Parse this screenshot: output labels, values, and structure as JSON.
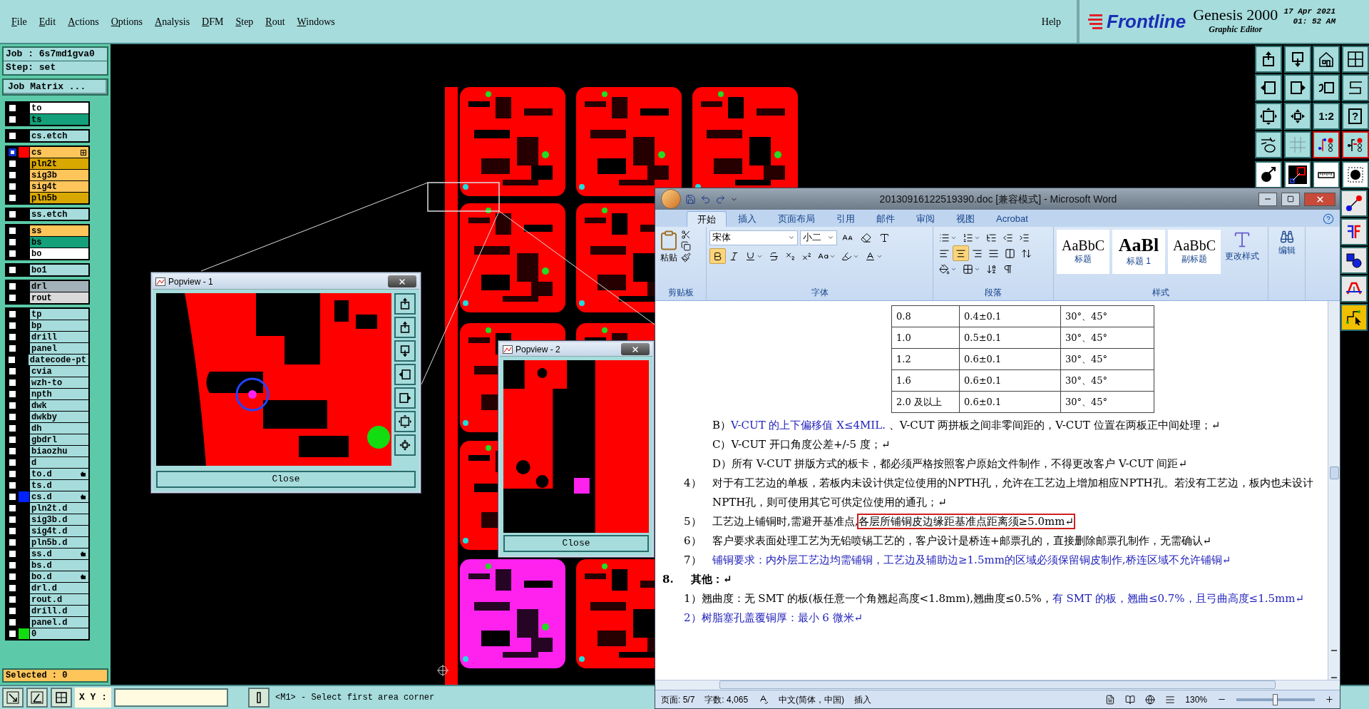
{
  "menubar": {
    "items": [
      "File",
      "Edit",
      "Actions",
      "Options",
      "Analysis",
      "DFM",
      "Step",
      "Rout",
      "Windows"
    ],
    "help": "Help"
  },
  "brand": {
    "logo": "Frontline",
    "product": "Genesis 2000",
    "subtitle": "Graphic Editor",
    "date": "17 Apr 2021",
    "time": "01: 52 AM"
  },
  "job": {
    "job": "Job : 6s7md1gva0",
    "step": "Step: set",
    "matrix_button": "Job Matrix ..."
  },
  "layer_groups": [
    [
      {
        "name": "to",
        "color": "#ffffff",
        "selected": false,
        "kind": "plain"
      },
      {
        "name": "ts",
        "color": "#13a07a",
        "selected": false,
        "kind": "plain"
      }
    ],
    [
      {
        "name": "cs.etch",
        "color": "#a6dcdc",
        "selected": false,
        "kind": "plain"
      }
    ],
    [
      {
        "name": "cs",
        "color": "#fdc55a",
        "selected": true,
        "kind": "expandable",
        "swatch": {
          "color": "#ff0000"
        }
      },
      {
        "name": "pln2t",
        "color": "#d9a800",
        "selected": false,
        "kind": "plain"
      },
      {
        "name": "sig3b",
        "color": "#fdc55a",
        "selected": false,
        "kind": "plain"
      },
      {
        "name": "sig4t",
        "color": "#fdc55a",
        "selected": false,
        "kind": "plain"
      },
      {
        "name": "pln5b",
        "color": "#d9a800",
        "selected": false,
        "kind": "plain"
      }
    ],
    [
      {
        "name": "ss.etch",
        "color": "#a6dcdc",
        "selected": false,
        "kind": "plain"
      }
    ],
    [
      {
        "name": "ss",
        "color": "#fdc55a",
        "selected": false,
        "kind": "plain"
      },
      {
        "name": "bs",
        "color": "#13a07a",
        "selected": false,
        "kind": "plain"
      },
      {
        "name": "bo",
        "color": "#ffffff",
        "selected": false,
        "kind": "plain"
      }
    ],
    [
      {
        "name": "bo1",
        "color": "#a6dcdc",
        "selected": false,
        "kind": "plain"
      }
    ],
    [
      {
        "name": "drl",
        "color": "#a3b2b8",
        "selected": false,
        "kind": "plain"
      },
      {
        "name": "rout",
        "color": "#d9d9d9",
        "selected": false,
        "kind": "plain"
      }
    ],
    [
      {
        "name": "tp",
        "color": "#a6dcdc",
        "selected": false,
        "kind": "plain"
      },
      {
        "name": "bp",
        "color": "#a6dcdc",
        "selected": false,
        "kind": "plain"
      },
      {
        "name": "drill",
        "color": "#a6dcdc",
        "selected": false,
        "kind": "plain"
      },
      {
        "name": "panel",
        "color": "#a6dcdc",
        "selected": false,
        "kind": "plain"
      },
      {
        "name": "datecode-pt",
        "color": "#a6dcdc",
        "selected": false,
        "kind": "plain"
      },
      {
        "name": "cvia",
        "color": "#a6dcdc",
        "selected": false,
        "kind": "plain"
      },
      {
        "name": "wzh-to",
        "color": "#a6dcdc",
        "selected": false,
        "kind": "plain"
      },
      {
        "name": "npth",
        "color": "#a6dcdc",
        "selected": false,
        "kind": "plain"
      },
      {
        "name": "dwk",
        "color": "#a6dcdc",
        "selected": false,
        "kind": "plain"
      },
      {
        "name": "dwkby",
        "color": "#a6dcdc",
        "selected": false,
        "kind": "plain"
      },
      {
        "name": "dh",
        "color": "#a6dcdc",
        "selected": false,
        "kind": "plain"
      },
      {
        "name": "gbdrl",
        "color": "#a6dcdc",
        "selected": false,
        "kind": "plain"
      },
      {
        "name": "biaozhu",
        "color": "#a6dcdc",
        "selected": false,
        "kind": "plain"
      },
      {
        "name": "d",
        "color": "#a6dcdc",
        "selected": false,
        "kind": "plain"
      },
      {
        "name": "to.d",
        "color": "#a6dcdc",
        "selected": false,
        "kind": "flagged"
      },
      {
        "name": "ts.d",
        "color": "#a6dcdc",
        "selected": false,
        "kind": "plain"
      },
      {
        "name": "cs.d",
        "color": "#a6dcdc",
        "selected": false,
        "kind": "flagged",
        "swatch": {
          "color": "#0022ff"
        }
      },
      {
        "name": "pln2t.d",
        "color": "#a6dcdc",
        "selected": false,
        "kind": "plain"
      },
      {
        "name": "sig3b.d",
        "color": "#a6dcdc",
        "selected": false,
        "kind": "plain"
      },
      {
        "name": "sig4t.d",
        "color": "#a6dcdc",
        "selected": false,
        "kind": "plain"
      },
      {
        "name": "pln5b.d",
        "color": "#a6dcdc",
        "selected": false,
        "kind": "plain"
      },
      {
        "name": "ss.d",
        "color": "#a6dcdc",
        "selected": false,
        "kind": "flagged"
      },
      {
        "name": "bs.d",
        "color": "#a6dcdc",
        "selected": false,
        "kind": "plain"
      },
      {
        "name": "bo.d",
        "color": "#a6dcdc",
        "selected": false,
        "kind": "flagged"
      },
      {
        "name": "drl.d",
        "color": "#a6dcdc",
        "selected": false,
        "kind": "plain"
      },
      {
        "name": "rout.d",
        "color": "#a6dcdc",
        "selected": false,
        "kind": "plain"
      },
      {
        "name": "drill.d",
        "color": "#a6dcdc",
        "selected": false,
        "kind": "plain"
      },
      {
        "name": "panel.d",
        "color": "#a6dcdc",
        "selected": false,
        "kind": "plain"
      },
      {
        "name": "0",
        "color": "#a6dcdc",
        "selected": false,
        "kind": "plain",
        "swatch": {
          "color": "#11dd11"
        }
      }
    ]
  ],
  "selected_count": "Selected : 0",
  "tool_texts": {
    "ratio": "1:2",
    "help": "?"
  },
  "bottom_bar": {
    "xy_label": "X Y :",
    "message": "<M1> - Select first area corner"
  },
  "popviews": [
    {
      "title": "Popview - 1",
      "close": "Close",
      "kind": "with_tools"
    },
    {
      "title": "Popview - 2",
      "close": "Close",
      "kind": "plain"
    }
  ],
  "word": {
    "title": "20130916122519390.doc [兼容模式] - Microsoft Word",
    "tabs": [
      {
        "label": "开始",
        "selected": true
      },
      {
        "label": "插入",
        "selected": false
      },
      {
        "label": "页面布局",
        "selected": false
      },
      {
        "label": "引用",
        "selected": false
      },
      {
        "label": "邮件",
        "selected": false
      },
      {
        "label": "审阅",
        "selected": false
      },
      {
        "label": "视图",
        "selected": false
      },
      {
        "label": "Acrobat",
        "selected": false
      }
    ],
    "clipboard": {
      "paste": "粘贴",
      "group": "剪贴板"
    },
    "font": {
      "font": "宋体",
      "size": "小二",
      "bold": true,
      "group": "字体"
    },
    "paragraph": {
      "align_buttons": [
        {
          "selected": false
        },
        {
          "selected": true
        },
        {
          "selected": false
        },
        {
          "selected": false
        }
      ],
      "group": "段落"
    },
    "styles": {
      "items": [
        {
          "sample": "AaBbC",
          "label": "标题",
          "kind": "normal"
        },
        {
          "sample": "AaBl",
          "label": "标题 1",
          "kind": "big"
        },
        {
          "sample": "AaBbC",
          "label": "副标题",
          "kind": "normal"
        }
      ],
      "change": "更改样式",
      "group": "样式"
    },
    "editing": {
      "label": "编辑"
    },
    "table": [
      [
        "0.8",
        "0.4±0.1",
        "30°、45°"
      ],
      [
        "1.0",
        "0.5±0.1",
        "30°、45°"
      ],
      [
        "1.2",
        "0.6±0.1",
        "30°、45°"
      ],
      [
        "1.6",
        "0.6±0.1",
        "30°、45°"
      ],
      [
        "2.0 及以上",
        "0.6±0.1",
        "30°、45°"
      ]
    ],
    "paragraphs": [
      {
        "kind": "sub",
        "runs": [
          {
            "text": "B）",
            "color": "#000000"
          },
          {
            "text": "V-CUT 的上下偏移值 X≤4MIL.",
            "color": "#2222bb"
          },
          {
            "text": " 、V-CUT 两拼板之间非零间距的，V-CUT  位置在两板正中间处理；↵",
            "color": "#000000"
          }
        ]
      },
      {
        "kind": "sub",
        "runs": [
          {
            "text": "C）V-CUT 开口角度公差+/-5 度；↵",
            "color": "#000000"
          }
        ]
      },
      {
        "kind": "sub",
        "runs": [
          {
            "text": "D）所有 V-CUT 拼版方式的板卡，都必须严格按照客户原始文件制作，不得更改客户 V-CUT 间距↵",
            "color": "#000000"
          }
        ]
      },
      {
        "kind": "item",
        "number": "4）",
        "runs": [
          {
            "text": "对于有工艺边的单板，若板内未设计供定位使用的NPTH孔，允许在工艺边上增加相应NPTH孔。若没有工艺边，板内也未设计NPTH孔，则可使用其它可供定位使用的通孔；↵",
            "color": "#000000"
          }
        ]
      },
      {
        "kind": "item",
        "number": "5）",
        "runs": [
          {
            "text": "工艺边上铺铜时,需避开基准点,",
            "color": "#000000"
          },
          {
            "text": "各层所铺铜皮边缘距基准点距离须≥5.0mm↵",
            "color": "#000000",
            "boxed": true
          }
        ]
      },
      {
        "kind": "item",
        "number": "6）",
        "runs": [
          {
            "text": "客户要求表面处理工艺为无铅喷锡工艺的，客户设计是桥连+邮票孔的，直接删除邮票孔制作，无需确认↵",
            "color": "#000000"
          }
        ]
      },
      {
        "kind": "item",
        "number": "7）",
        "runs": [
          {
            "text": "铺铜要求：内外层工艺边均需铺铜，工艺边及辅助边≥1.5mm的区域必须保留铜皮制作,桥连区域不允许铺铜↵",
            "color": "#2222bb"
          }
        ]
      },
      {
        "kind": "heading",
        "number": "8.",
        "runs": [
          {
            "text": "其他：↵",
            "color": "#000000"
          }
        ]
      },
      {
        "kind": "indent",
        "runs": [
          {
            "text": "1）翘曲度：无 SMT 的板(板任意一个角翘起高度<1.8mm),翘曲度≤0.5%，",
            "color": "#000000"
          },
          {
            "text": "有 SMT 的板，翘曲≤0.7%，且弓曲高度≤1.5mm↵",
            "color": "#2222bb"
          }
        ]
      },
      {
        "kind": "indent",
        "runs": [
          {
            "text": "2）树脂塞孔盖覆铜厚：最小 6 微米↵",
            "color": "#2222bb"
          }
        ]
      }
    ],
    "status": {
      "page": "页面: 5/7",
      "words": "字数: 4,065",
      "language": "中文(简体，中国)",
      "mode": "插入",
      "zoom": "130%"
    },
    "zoom_slider": {
      "level": 0.5
    }
  }
}
